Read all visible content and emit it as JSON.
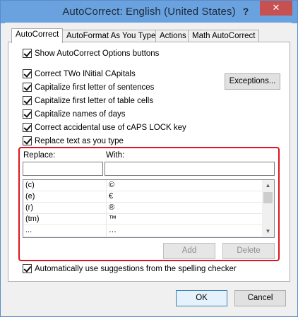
{
  "window": {
    "title": "AutoCorrect: English (United States)",
    "help_label": "?",
    "close_label": "✕"
  },
  "tabs": [
    {
      "label": "AutoCorrect",
      "active": true
    },
    {
      "label": "AutoFormat As You Type",
      "active": false
    },
    {
      "label": "Actions",
      "active": false
    },
    {
      "label": "Math AutoCorrect",
      "active": false
    }
  ],
  "options": {
    "show_buttons": "Show AutoCorrect Options buttons",
    "two_initial_caps": "Correct TWo INitial CApitals",
    "capitalize_sentences": "Capitalize first letter of sentences",
    "capitalize_table_cells": "Capitalize first letter of table cells",
    "capitalize_days": "Capitalize names of days",
    "caps_lock": "Correct accidental use of cAPS LOCK key",
    "replace_text": "Replace text as you type",
    "spelling_suggestions": "Automatically use suggestions from the spelling checker"
  },
  "buttons": {
    "exceptions": "Exceptions...",
    "add": "Add",
    "delete": "Delete",
    "ok": "OK",
    "cancel": "Cancel"
  },
  "replace_section": {
    "replace_label": "Replace:",
    "with_label": "With:",
    "replace_value": "",
    "with_value": ""
  },
  "entries": [
    {
      "replace": "(c)",
      "with": "©"
    },
    {
      "replace": "(e)",
      "with": "€"
    },
    {
      "replace": "(r)",
      "with": "®"
    },
    {
      "replace": "(tm)",
      "with": "™"
    },
    {
      "replace": "...",
      "with": "…"
    }
  ],
  "colors": {
    "highlight_border": "#e0141e",
    "title_bar": "#6aa2e0",
    "close_button": "#c75050"
  }
}
